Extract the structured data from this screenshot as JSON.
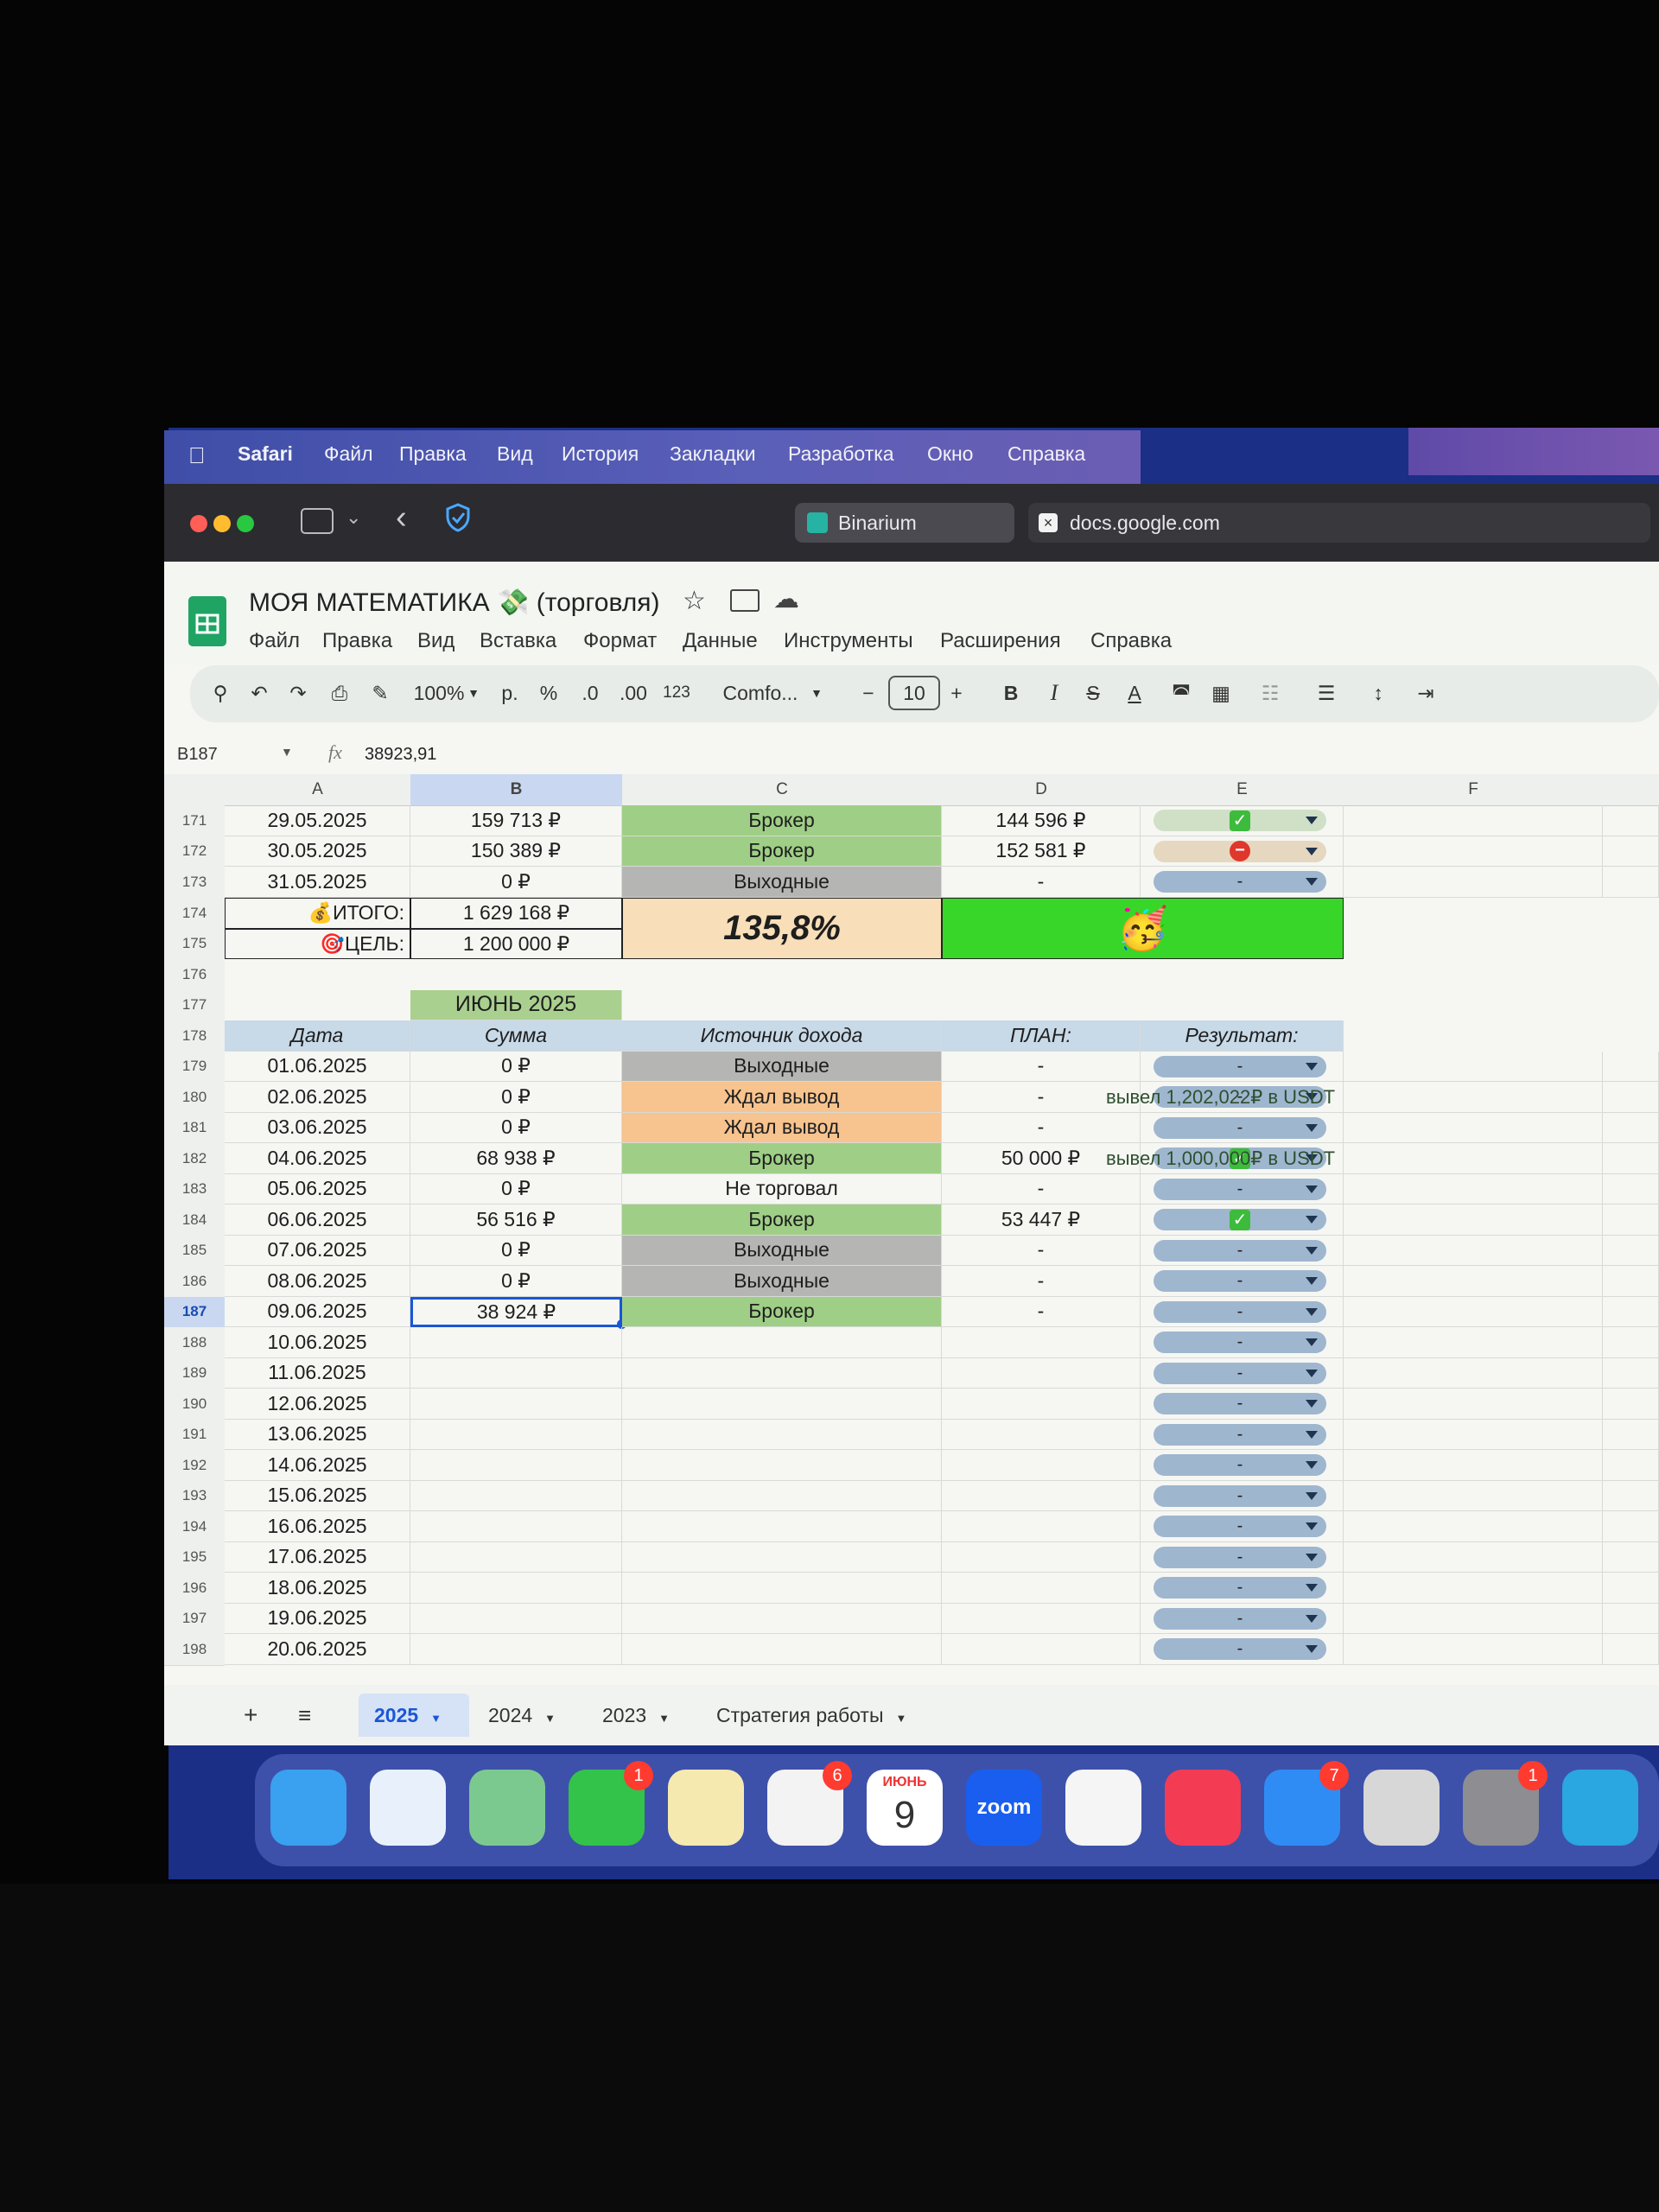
{
  "menubar": {
    "app": "Safari",
    "items": [
      "Файл",
      "Правка",
      "Вид",
      "История",
      "Закладки",
      "Разработка",
      "Окно",
      "Справка"
    ]
  },
  "browser": {
    "tabs": [
      {
        "label": "Binarium",
        "active": true
      },
      {
        "label": "docs.google.com",
        "active": false
      }
    ]
  },
  "doc": {
    "title": "МОЯ МАТЕМАТИКА 💸 (торговля)",
    "menu": [
      "Файл",
      "Правка",
      "Вид",
      "Вставка",
      "Формат",
      "Данные",
      "Инструменты",
      "Расширения",
      "Справка"
    ],
    "toolbar": {
      "zoom": "100%",
      "currency": "р.",
      "percent": "%",
      "dec_less": ".0",
      "dec_more": ".00",
      "number_format": "123",
      "font": "Comfo...",
      "font_size": "10"
    },
    "name_box": "B187",
    "formula": "38923,91"
  },
  "columns": [
    "A",
    "B",
    "C",
    "D",
    "E",
    "F"
  ],
  "rows": [
    {
      "n": "171",
      "a": "29.05.2025",
      "b": "159 713 ₽",
      "c": "Брокер",
      "c_color": "#9fcf86",
      "d": "144 596 ₽",
      "e": "check",
      "e_bg": "#cfe0c6"
    },
    {
      "n": "172",
      "a": "30.05.2025",
      "b": "150 389 ₽",
      "c": "Брокер",
      "c_color": "#9fcf86",
      "d": "152 581 ₽",
      "e": "stop",
      "e_bg": "#e6d8c0"
    },
    {
      "n": "173",
      "a": "31.05.2025",
      "b": "0 ₽",
      "c": "Выходные",
      "c_color": "#b5b6b3",
      "d": "-",
      "e": "-",
      "e_bg": "#9fb6cf"
    }
  ],
  "summary": {
    "total_label": "💰ИТОГО:",
    "total_value": "1 629 168 ₽",
    "goal_label": "🎯ЦЕЛЬ:",
    "goal_value": "1 200 000 ₽",
    "percent": "135,8%",
    "emoji": "🥳"
  },
  "june": {
    "title": "ИЮНЬ 2025",
    "headers": [
      "Дата",
      "Сумма",
      "Источник дохода",
      "ПЛАН:",
      "Результат:"
    ],
    "rows": [
      {
        "n": "179",
        "a": "01.06.2025",
        "b": "0 ₽",
        "c": "Выходные",
        "c_color": "#b5b6b3",
        "d": "-",
        "e": "-",
        "f": ""
      },
      {
        "n": "180",
        "a": "02.06.2025",
        "b": "0 ₽",
        "c": "Ждал вывод",
        "c_color": "#f7c38e",
        "d": "-",
        "e": "-",
        "f": "вывел 1,202,022₽ в USDT"
      },
      {
        "n": "181",
        "a": "03.06.2025",
        "b": "0 ₽",
        "c": "Ждал вывод",
        "c_color": "#f7c38e",
        "d": "-",
        "e": "-",
        "f": ""
      },
      {
        "n": "182",
        "a": "04.06.2025",
        "b": "68 938 ₽",
        "c": "Брокер",
        "c_color": "#9fcf86",
        "d": "50 000 ₽",
        "e": "check",
        "f": "вывел 1,000,000₽ в USDT"
      },
      {
        "n": "183",
        "a": "05.06.2025",
        "b": "0 ₽",
        "c": "Не торговал",
        "c_color": "#f6f7f3",
        "d": "-",
        "e": "-",
        "f": ""
      },
      {
        "n": "184",
        "a": "06.06.2025",
        "b": "56 516 ₽",
        "c": "Брокер",
        "c_color": "#9fcf86",
        "d": "53 447 ₽",
        "e": "check",
        "f": ""
      },
      {
        "n": "185",
        "a": "07.06.2025",
        "b": "0 ₽",
        "c": "Выходные",
        "c_color": "#b5b6b3",
        "d": "-",
        "e": "-",
        "f": ""
      },
      {
        "n": "186",
        "a": "08.06.2025",
        "b": "0 ₽",
        "c": "Выходные",
        "c_color": "#b5b6b3",
        "d": "-",
        "e": "-",
        "f": ""
      },
      {
        "n": "187",
        "a": "09.06.2025",
        "b": "38 924 ₽",
        "c": "Брокер",
        "c_color": "#9fcf86",
        "d": "-",
        "e": "-",
        "f": ""
      },
      {
        "n": "188",
        "a": "10.06.2025",
        "b": "",
        "c": "",
        "c_color": "",
        "d": "",
        "e": "-",
        "f": ""
      },
      {
        "n": "189",
        "a": "11.06.2025",
        "b": "",
        "c": "",
        "c_color": "",
        "d": "",
        "e": "-",
        "f": ""
      },
      {
        "n": "190",
        "a": "12.06.2025",
        "b": "",
        "c": "",
        "c_color": "",
        "d": "",
        "e": "-",
        "f": ""
      },
      {
        "n": "191",
        "a": "13.06.2025",
        "b": "",
        "c": "",
        "c_color": "",
        "d": "",
        "e": "-",
        "f": ""
      },
      {
        "n": "192",
        "a": "14.06.2025",
        "b": "",
        "c": "",
        "c_color": "",
        "d": "",
        "e": "-",
        "f": ""
      },
      {
        "n": "193",
        "a": "15.06.2025",
        "b": "",
        "c": "",
        "c_color": "",
        "d": "",
        "e": "-",
        "f": ""
      },
      {
        "n": "194",
        "a": "16.06.2025",
        "b": "",
        "c": "",
        "c_color": "",
        "d": "",
        "e": "-",
        "f": ""
      },
      {
        "n": "195",
        "a": "17.06.2025",
        "b": "",
        "c": "",
        "c_color": "",
        "d": "",
        "e": "-",
        "f": ""
      },
      {
        "n": "196",
        "a": "18.06.2025",
        "b": "",
        "c": "",
        "c_color": "",
        "d": "",
        "e": "-",
        "f": ""
      },
      {
        "n": "197",
        "a": "19.06.2025",
        "b": "",
        "c": "",
        "c_color": "",
        "d": "",
        "e": "-",
        "f": ""
      },
      {
        "n": "198",
        "a": "20.06.2025",
        "b": "",
        "c": "",
        "c_color": "",
        "d": "",
        "e": "-",
        "f": ""
      }
    ]
  },
  "sheet_tabs": [
    {
      "label": "2025",
      "active": true
    },
    {
      "label": "2024",
      "active": false
    },
    {
      "label": "2023",
      "active": false
    },
    {
      "label": "Стратегия работы",
      "active": false
    }
  ],
  "dock": {
    "apps": [
      {
        "name": "Finder",
        "icon": "finder-icon",
        "color": "#3aa0f0"
      },
      {
        "name": "Safari",
        "icon": "safari-icon",
        "color": "#e8f1fb"
      },
      {
        "name": "Maps",
        "icon": "maps-icon",
        "color": "#7cc98f"
      },
      {
        "name": "FaceTime",
        "icon": "facetime-icon",
        "color": "#33c24a",
        "badge": "1"
      },
      {
        "name": "Notes",
        "icon": "notes-icon",
        "color": "#f6e9b0"
      },
      {
        "name": "Reminders",
        "icon": "reminders-icon",
        "color": "#f3f3f3",
        "badge": "6"
      },
      {
        "name": "Calendar",
        "icon": "calendar-icon",
        "color": "#ffffff",
        "month": "ИЮНЬ",
        "day": "9"
      },
      {
        "name": "Zoom",
        "icon": "zoom-icon",
        "color": "#1a5ef0",
        "text": "zoom"
      },
      {
        "name": "Freeform",
        "icon": "freeform-icon",
        "color": "#f5f5f5"
      },
      {
        "name": "Music",
        "icon": "music-icon",
        "color": "#f43b54"
      },
      {
        "name": "App Store",
        "icon": "appstore-icon",
        "color": "#2f8cf5",
        "badge": "7"
      },
      {
        "name": "Calculator",
        "icon": "calculator-icon",
        "color": "#d7d7d7"
      },
      {
        "name": "System Settings",
        "icon": "settings-icon",
        "color": "#8d8d92",
        "badge": "1"
      },
      {
        "name": "Telegram",
        "icon": "telegram-icon",
        "color": "#2aa6e0"
      }
    ]
  }
}
